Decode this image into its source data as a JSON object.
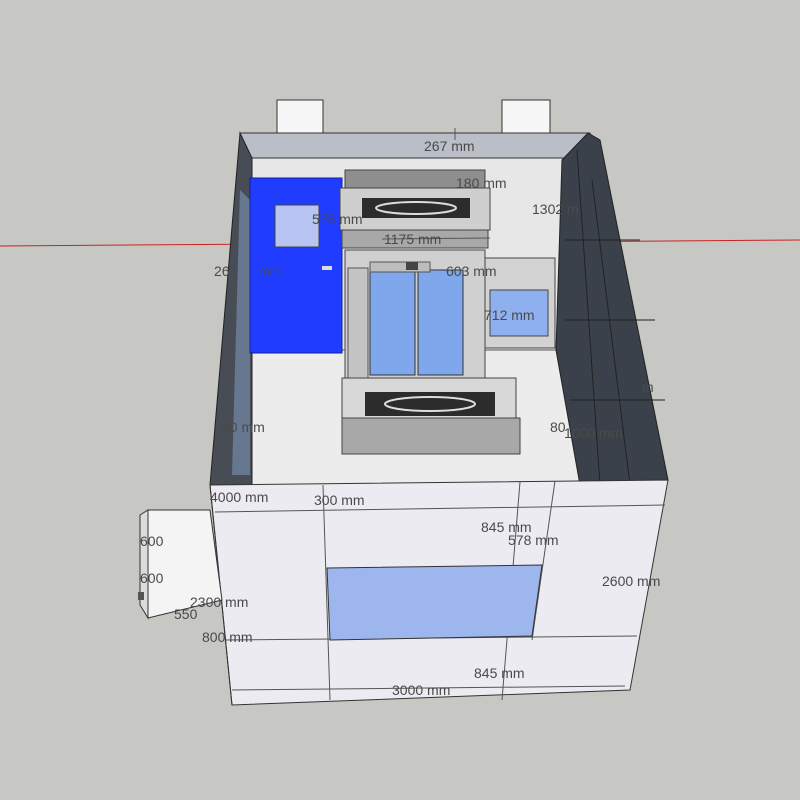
{
  "scene": {
    "colors": {
      "background": "#c7c8c4",
      "wall_face": "#ecebf2",
      "wall_dark": "#3a3f48",
      "door": "#1f3cff",
      "glass": "#9db6ee",
      "steel": "#c9c9c9",
      "axis_red": "#cc2222"
    },
    "dimensions": {
      "d_267": "267 mm",
      "d_180": "180 mm",
      "d_1302": "1302 m",
      "d_575": "575 mm",
      "d_1175": "1175 mm",
      "d_26": "26",
      "d_mm_left": "mm",
      "d_603": "603 mm",
      "d_712": "712 mm",
      "d_m_right": "m",
      "d_00": "00 mm",
      "d_80": "80",
      "d_1000": "1000 mm",
      "d_4000": "4000 mm",
      "d_300": "300 mm",
      "d_845_top": "845 mm",
      "d_578": "578 mm",
      "d_600_a": "600",
      "d_600_b": "600",
      "d_2300": "2300 mm",
      "d_550": "550",
      "d_2600": "2600 mm",
      "d_800": "800 mm",
      "d_845_bottom": "845 mm",
      "d_3000": "3000 mm"
    }
  }
}
